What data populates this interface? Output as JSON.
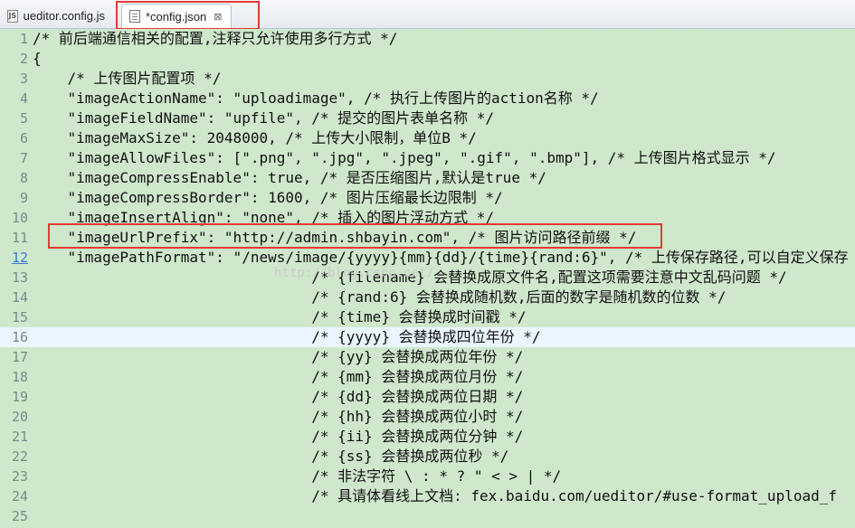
{
  "tabs": [
    {
      "label": "ueditor.config.js",
      "icon": "js-file-icon",
      "active": false
    },
    {
      "label": "*config.json",
      "icon": "json-file-icon",
      "active": true,
      "close": "⊠"
    }
  ],
  "watermark": "http://blog.csdn.net/",
  "current_line": 16,
  "lines": [
    {
      "n": "1",
      "text": "/* 前后端通信相关的配置,注释只允许使用多行方式 */"
    },
    {
      "n": "2",
      "text": "{"
    },
    {
      "n": "3",
      "text": "    /* 上传图片配置项 */"
    },
    {
      "n": "4",
      "text": "    \"imageActionName\": \"uploadimage\", /* 执行上传图片的action名称 */"
    },
    {
      "n": "5",
      "text": "    \"imageFieldName\": \"upfile\", /* 提交的图片表单名称 */"
    },
    {
      "n": "6",
      "text": "    \"imageMaxSize\": 2048000, /* 上传大小限制，单位B */"
    },
    {
      "n": "7",
      "text": "    \"imageAllowFiles\": [\".png\", \".jpg\", \".jpeg\", \".gif\", \".bmp\"], /* 上传图片格式显示 */"
    },
    {
      "n": "8",
      "text": "    \"imageCompressEnable\": true, /* 是否压缩图片,默认是true */"
    },
    {
      "n": "9",
      "text": "    \"imageCompressBorder\": 1600, /* 图片压缩最长边限制 */"
    },
    {
      "n": "10",
      "text": "    \"imageInsertAlign\": \"none\", /* 插入的图片浮动方式 */"
    },
    {
      "n": "11",
      "text": "    \"imageUrlPrefix\": \"http://admin.shbayin.com\", /* 图片访问路径前缀 */"
    },
    {
      "n": "12",
      "text": "    \"imagePathFormat\": \"/news/image/{yyyy}{mm}{dd}/{time}{rand:6}\", /* 上传保存路径,可以自定义保存"
    },
    {
      "n": "13",
      "text": "                                /* {filename} 会替换成原文件名,配置这项需要注意中文乱码问题 */"
    },
    {
      "n": "14",
      "text": "                                /* {rand:6} 会替换成随机数,后面的数字是随机数的位数 */"
    },
    {
      "n": "15",
      "text": "                                /* {time} 会替换成时间戳 */"
    },
    {
      "n": "16",
      "text": "                                /* {yyyy} 会替换成四位年份 */"
    },
    {
      "n": "17",
      "text": "                                /* {yy} 会替换成两位年份 */"
    },
    {
      "n": "18",
      "text": "                                /* {mm} 会替换成两位月份 */"
    },
    {
      "n": "19",
      "text": "                                /* {dd} 会替换成两位日期 */"
    },
    {
      "n": "20",
      "text": "                                /* {hh} 会替换成两位小时 */"
    },
    {
      "n": "21",
      "text": "                                /* {ii} 会替换成两位分钟 */"
    },
    {
      "n": "22",
      "text": "                                /* {ss} 会替换成两位秒 */"
    },
    {
      "n": "23",
      "text": "                                /* 非法字符 \\ : * ? \" < > | */"
    },
    {
      "n": "24",
      "text": "                                /* 具请体看线上文档: fex.baidu.com/ueditor/#use-format_upload_f"
    },
    {
      "n": "25",
      "text": ""
    }
  ],
  "colors": {
    "editor_bg": "#cfe8cc",
    "current_line_bg": "#eaf6ff",
    "highlight_box": "#e53935"
  }
}
